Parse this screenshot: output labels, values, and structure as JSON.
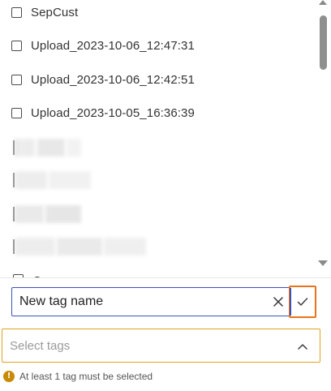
{
  "tag_list": {
    "options": [
      {
        "label": "SepCust",
        "checked": false
      },
      {
        "label": "Upload_2023-10-06_12:47:31",
        "checked": false
      },
      {
        "label": "Upload_2023-10-06_12:42:51",
        "checked": false
      },
      {
        "label": "Upload_2023-10-05_16:36:39",
        "checked": false
      }
    ],
    "partial_option_label": "C"
  },
  "new_tag": {
    "value": "New tag name",
    "clear_icon": "close-icon",
    "confirm_icon": "checkmark-icon"
  },
  "select_tags": {
    "placeholder": "Select tags",
    "chevron_icon": "chevron-up-icon"
  },
  "validation": {
    "icon": "warning-icon",
    "message": "At least 1 tag must be selected"
  },
  "colors": {
    "input_border": "#3f51b5",
    "confirm_border": "#e8731a",
    "select_border": "#e0a31c",
    "warning": "#c98a07"
  }
}
